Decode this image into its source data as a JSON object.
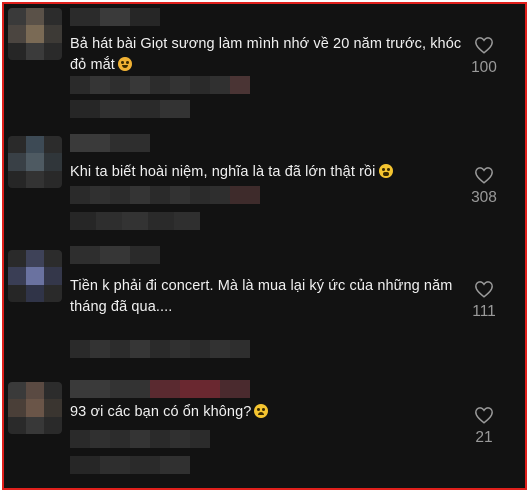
{
  "comments": [
    {
      "text": "Bả hát bài Giọt sương làm mình nhớ về 20 năm trước, khóc đỏ mắt",
      "emoji": "heart-eyes-emoji",
      "likes": "100"
    },
    {
      "text": "Khi ta biết hoài niệm, nghĩa là ta đã lớn thật rồi",
      "emoji": "tired-emoji",
      "likes": "308"
    },
    {
      "text": "Tiền k phải đi concert. Mà là mua lại ký ức của những năm tháng đã qua....",
      "emoji": "",
      "likes": "111"
    },
    {
      "text": "93 ơi các bạn có ổn không?",
      "emoji": "worried-emoji",
      "likes": "21"
    }
  ],
  "colors": {
    "background": "#121212",
    "text": "#f1f1f1",
    "muted": "#9a9a9a",
    "frame_border": "#e0201c"
  },
  "icons": {
    "like": "heart-outline-icon"
  }
}
